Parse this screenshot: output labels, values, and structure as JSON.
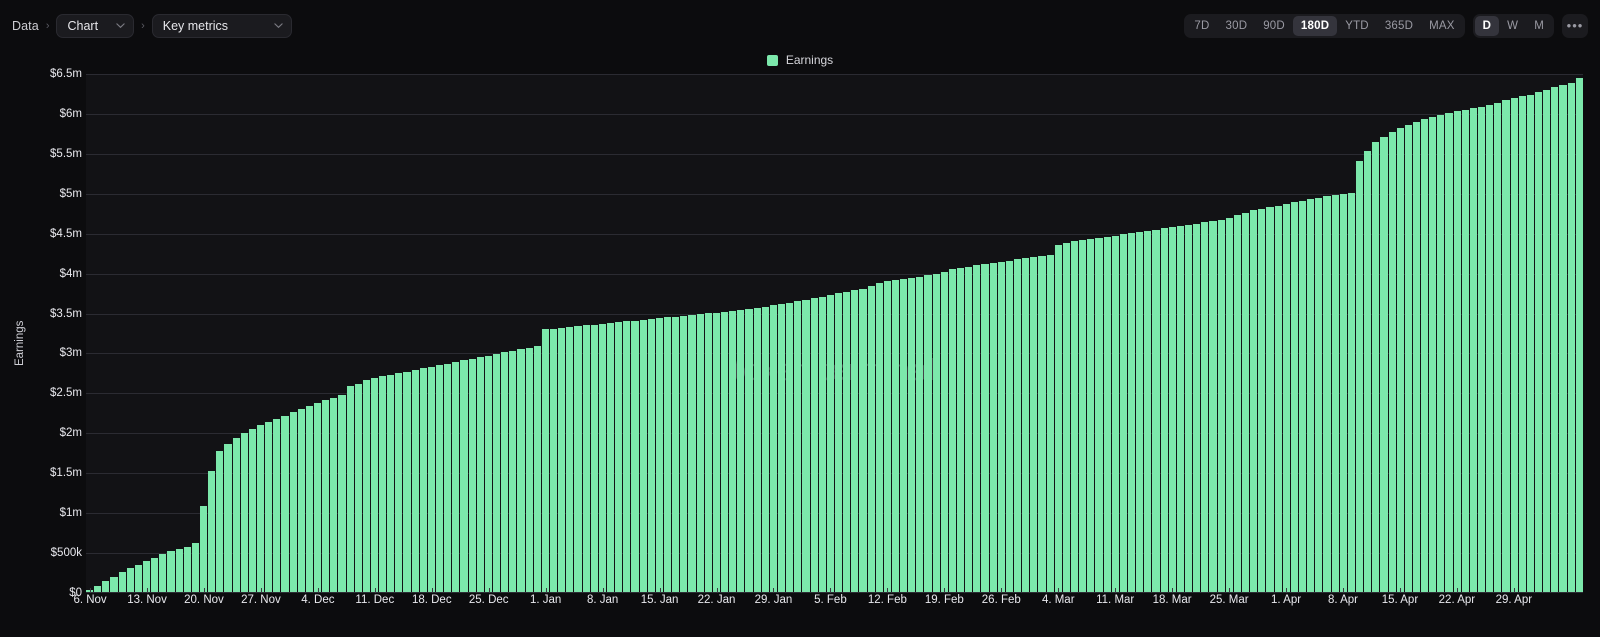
{
  "breadcrumb": {
    "root_label": "Data",
    "sep": "›",
    "chart_label": "Chart",
    "metrics_label": "Key metrics"
  },
  "toolbar": {
    "ranges": [
      {
        "label": "7D",
        "active": false
      },
      {
        "label": "30D",
        "active": false
      },
      {
        "label": "90D",
        "active": false
      },
      {
        "label": "180D",
        "active": true
      },
      {
        "label": "YTD",
        "active": false
      },
      {
        "label": "365D",
        "active": false
      },
      {
        "label": "MAX",
        "active": false
      }
    ],
    "intervals": [
      {
        "label": "D",
        "active": true
      },
      {
        "label": "W",
        "active": false
      },
      {
        "label": "M",
        "active": false
      }
    ],
    "more_label": "•••"
  },
  "legend": {
    "items": [
      {
        "label": "Earnings",
        "color": "#7ce8ab"
      }
    ]
  },
  "watermark": "token terminal",
  "colors": {
    "accent": "#7ce8ab",
    "background": "#0c0c0e",
    "plot_background": "#121215",
    "gridline": "#2b2b32",
    "axis_text": "#e9e9ee"
  },
  "chart_data": {
    "type": "bar",
    "title": "",
    "subtitle": "",
    "xlabel": "",
    "ylabel": "Earnings",
    "grid": true,
    "legend_position": "top-center",
    "ylim": [
      0,
      6500000
    ],
    "ytick_labels": [
      "$0",
      "$500k",
      "$1m",
      "$1.5m",
      "$2m",
      "$2.5m",
      "$3m",
      "$3.5m",
      "$4m",
      "$4.5m",
      "$5m",
      "$5.5m",
      "$6m",
      "$6.5m"
    ],
    "ytick_values": [
      0,
      500000,
      1000000,
      1500000,
      2000000,
      2500000,
      3000000,
      3500000,
      4000000,
      4500000,
      5000000,
      5500000,
      6000000,
      6500000
    ],
    "xtick_labels": [
      "6. Nov",
      "13. Nov",
      "20. Nov",
      "27. Nov",
      "4. Dec",
      "11. Dec",
      "18. Dec",
      "25. Dec",
      "1. Jan",
      "8. Jan",
      "15. Jan",
      "22. Jan",
      "29. Jan",
      "5. Feb",
      "12. Feb",
      "19. Feb",
      "26. Feb",
      "4. Mar",
      "11. Mar",
      "18. Mar",
      "25. Mar",
      "1. Apr",
      "8. Apr",
      "15. Apr",
      "22. Apr",
      "29. Apr"
    ],
    "xtick_indices": [
      0,
      7,
      14,
      21,
      28,
      35,
      42,
      49,
      56,
      63,
      70,
      77,
      84,
      91,
      98,
      105,
      112,
      119,
      126,
      133,
      140,
      147,
      154,
      161,
      168,
      175
    ],
    "series": [
      {
        "name": "Earnings",
        "color": "#7ce8ab",
        "values": [
          30000,
          80000,
          140000,
          190000,
          250000,
          300000,
          340000,
          390000,
          430000,
          470000,
          510000,
          540000,
          570000,
          620000,
          1080000,
          1520000,
          1760000,
          1860000,
          1930000,
          1990000,
          2040000,
          2090000,
          2130000,
          2170000,
          2210000,
          2250000,
          2290000,
          2330000,
          2370000,
          2400000,
          2430000,
          2470000,
          2580000,
          2610000,
          2650000,
          2680000,
          2700000,
          2720000,
          2740000,
          2760000,
          2780000,
          2800000,
          2820000,
          2840000,
          2860000,
          2880000,
          2900000,
          2920000,
          2940000,
          2960000,
          2980000,
          3000000,
          3020000,
          3040000,
          3060000,
          3080000,
          3290000,
          3300000,
          3310000,
          3320000,
          3330000,
          3340000,
          3350000,
          3360000,
          3370000,
          3380000,
          3390000,
          3400000,
          3410000,
          3420000,
          3430000,
          3440000,
          3450000,
          3460000,
          3470000,
          3480000,
          3490000,
          3500000,
          3510000,
          3520000,
          3530000,
          3545000,
          3560000,
          3575000,
          3590000,
          3605000,
          3620000,
          3640000,
          3660000,
          3680000,
          3700000,
          3720000,
          3740000,
          3760000,
          3780000,
          3800000,
          3830000,
          3870000,
          3890000,
          3905000,
          3920000,
          3935000,
          3950000,
          3965000,
          3980000,
          4010000,
          4040000,
          4060000,
          4075000,
          4090000,
          4105000,
          4120000,
          4135000,
          4150000,
          4165000,
          4180000,
          4195000,
          4210000,
          4225000,
          4350000,
          4370000,
          4390000,
          4405000,
          4420000,
          4435000,
          4450000,
          4465000,
          4480000,
          4495000,
          4510000,
          4525000,
          4540000,
          4555000,
          4570000,
          4585000,
          4600000,
          4615000,
          4630000,
          4645000,
          4665000,
          4690000,
          4720000,
          4750000,
          4780000,
          4800000,
          4820000,
          4840000,
          4860000,
          4880000,
          4900000,
          4920000,
          4940000,
          4955000,
          4970000,
          4985000,
          5000000,
          5400000,
          5520000,
          5630000,
          5700000,
          5760000,
          5810000,
          5850000,
          5890000,
          5920000,
          5950000,
          5980000,
          6000000,
          6020000,
          6040000,
          6060000,
          6080000,
          6100000,
          6130000,
          6160000,
          6190000,
          6210000,
          6230000,
          6260000,
          6290000,
          6320000,
          6350000,
          6380000,
          6440000
        ]
      }
    ]
  }
}
